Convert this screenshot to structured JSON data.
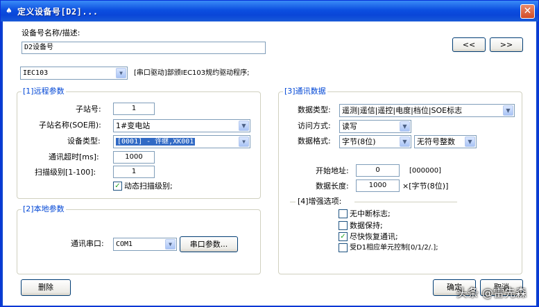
{
  "window": {
    "title": "定义设备号[D2]...",
    "icon": "device-icon",
    "close": "✕"
  },
  "device_desc": {
    "label": "设备号名称/描述:",
    "value": "D2设备号",
    "prev": "<<",
    "next": ">>"
  },
  "driver": {
    "selected": "IEC103",
    "note": "[串口驱动]部颁IEC103规约驱动程序;"
  },
  "remote": {
    "title": "[1]远程参数",
    "station_no_label": "子站号:",
    "station_no": "1",
    "station_name_label": "子站名称(SOE用):",
    "station_name": "1#变电站",
    "device_type_label": "设备类型:",
    "device_type": "[0001] - 许继,XK001",
    "timeout_label": "通讯超时[ms]:",
    "timeout": "1000",
    "scan_label": "扫描级别[1-100]:",
    "scan": "1",
    "dynamic_scan_label": "动态扫描级别;",
    "dynamic_scan_checked": true
  },
  "local": {
    "title": "[2]本地参数",
    "port_label": "通讯串口:",
    "port": "COM1",
    "port_params": "串口参数..."
  },
  "comm": {
    "title": "[3]通讯数据",
    "data_type_label": "数据类型:",
    "data_type": "遥测|遥信|遥控|电度|档位|SOE标志",
    "access_label": "访问方式:",
    "access": "读写",
    "format_label": "数据格式:",
    "format": "字节(8位)",
    "format2": "无符号整数",
    "start_label": "开始地址:",
    "start": "0",
    "start_hex": "[000000]",
    "length_label": "数据长度:",
    "length": "1000",
    "length_unit": "×[字节(8位)]"
  },
  "enhance": {
    "title": "[4]增强选项:",
    "options": [
      {
        "label": "无中断标志;",
        "checked": false
      },
      {
        "label": "数据保持;",
        "checked": false
      },
      {
        "label": "尽快恢复通讯;",
        "checked": true
      },
      {
        "label": "受D1相应单元控制[0/1/2/.];",
        "checked": false
      }
    ]
  },
  "footer": {
    "delete": "删除",
    "ok": "确定",
    "cancel": "取消"
  },
  "watermark": "头条 @雷先森"
}
